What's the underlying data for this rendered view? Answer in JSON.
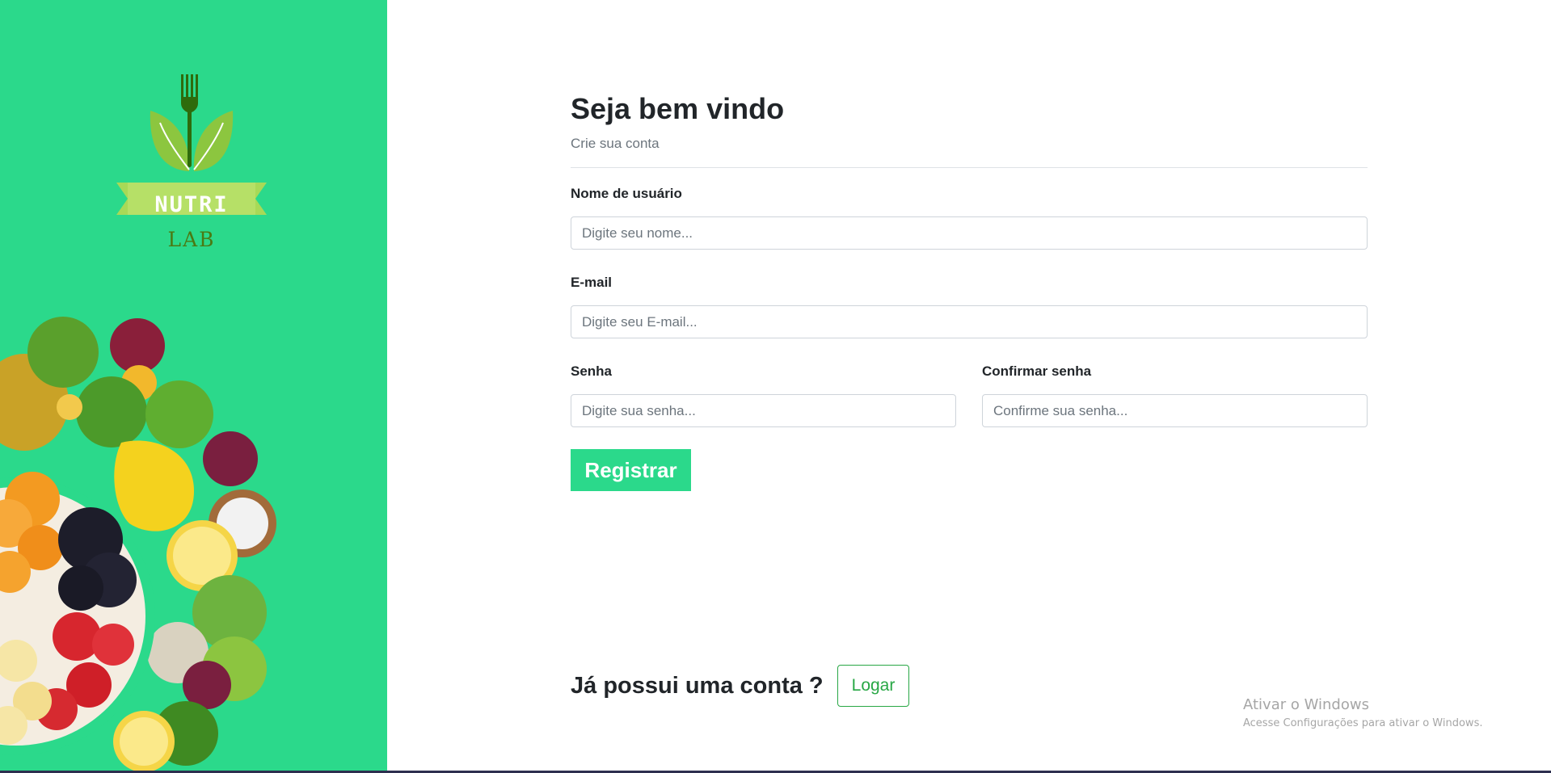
{
  "brand": {
    "name_top": "NUTRI",
    "name_bottom": "LAB",
    "banner_color": "#a8d957",
    "text_color": "#4a7a12",
    "fork_color": "#3b7a0e"
  },
  "sidebar": {
    "background": "#2bd98b"
  },
  "header": {
    "title": "Seja bem vindo",
    "subtitle": "Crie sua conta"
  },
  "form": {
    "username": {
      "label": "Nome de usuário",
      "placeholder": "Digite seu nome...",
      "value": ""
    },
    "email": {
      "label": "E-mail",
      "placeholder": "Digite seu E-mail...",
      "value": ""
    },
    "password": {
      "label": "Senha",
      "placeholder": "Digite sua senha...",
      "value": ""
    },
    "confirm_password": {
      "label": "Confirmar senha",
      "placeholder": "Confirme sua senha...",
      "value": ""
    },
    "submit_label": "Registrar"
  },
  "login": {
    "question": "Já possui uma conta ?",
    "button_label": "Logar"
  },
  "watermark": {
    "title": "Ativar o Windows",
    "subtitle": "Acesse Configurações para ativar o Windows."
  },
  "colors": {
    "accent": "#2bd98b",
    "success_outline": "#28a745"
  }
}
